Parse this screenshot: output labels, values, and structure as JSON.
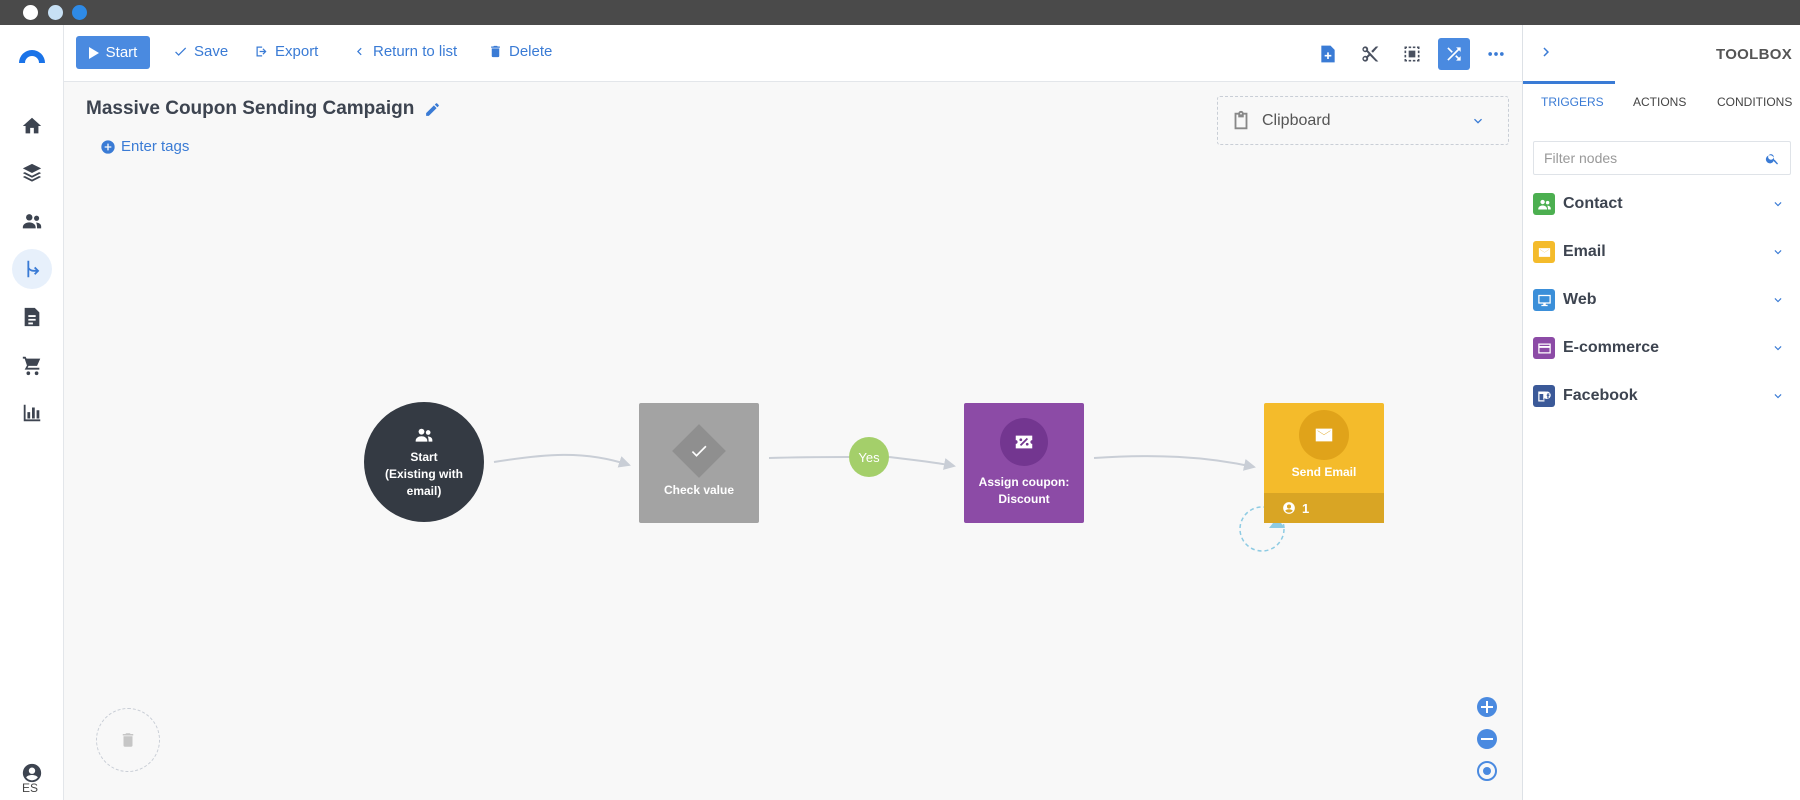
{
  "window": {
    "dot_colors": [
      "#ffffff",
      "#c7e0f4",
      "#2e8ae6"
    ]
  },
  "nav": {
    "items": [
      "home-icon",
      "layers-icon",
      "contacts-icon",
      "automation-icon",
      "document-icon",
      "cart-icon",
      "reports-icon"
    ],
    "active": "automation-icon",
    "user_icon": "user-circle-icon",
    "language": "ES"
  },
  "toolbar": {
    "start_label": "Start",
    "save_label": "Save",
    "export_label": "Export",
    "return_label": "Return to list",
    "delete_label": "Delete",
    "right_icons": [
      "add-node-icon",
      "scissors-icon",
      "select-area-icon",
      "shuffle-icon",
      "more-icon"
    ],
    "active_icon": "shuffle-icon"
  },
  "campaign": {
    "title": "Massive Coupon Sending Campaign",
    "tags_placeholder": "Enter tags"
  },
  "clipboard": {
    "label": "Clipboard"
  },
  "flow": {
    "start_node": {
      "line1": "Start",
      "line2": "(Existing with",
      "line3": "email)"
    },
    "check_node": {
      "label": "Check value"
    },
    "yes_label": "Yes",
    "coupon_node": {
      "line1": "Assign coupon:",
      "line2": "Discount"
    },
    "email_node": {
      "label": "Send Email",
      "count": "1"
    },
    "colors": {
      "start": "#343a43",
      "check": "#a3a3a3",
      "coupon": "#8c4ba6",
      "email": "#f4bb2b",
      "yes": "#a4cf6a"
    }
  },
  "toolbox": {
    "title": "TOOLBOX",
    "tabs": [
      "TRIGGERS",
      "ACTIONS",
      "CONDITIONS"
    ],
    "active_tab": "TRIGGERS",
    "filter_placeholder": "Filter nodes",
    "categories": [
      {
        "label": "Contact",
        "color": "#4caf50",
        "icon": "contacts-icon"
      },
      {
        "label": "Email",
        "color": "#f4bb2b",
        "icon": "email-icon"
      },
      {
        "label": "Web",
        "color": "#3b8fd9",
        "icon": "monitor-icon"
      },
      {
        "label": "E-commerce",
        "color": "#8c4ba6",
        "icon": "card-icon"
      },
      {
        "label": "Facebook",
        "color": "#3b5998",
        "icon": "facebook-icon"
      }
    ]
  },
  "zoom_controls": [
    "zoom-in-icon",
    "zoom-out-icon",
    "center-icon"
  ]
}
